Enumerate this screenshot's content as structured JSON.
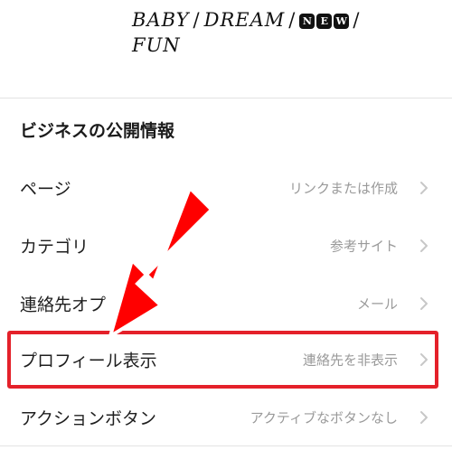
{
  "bio": {
    "line1_a": "BABY",
    "line1_b": "DREAM",
    "line1_badge": [
      "N",
      "E",
      "W"
    ],
    "line2": "FUN",
    "separator": "/"
  },
  "section": {
    "title": "ビジネスの公開情報"
  },
  "rows": [
    {
      "label": "ページ",
      "value": "リンクまたは作成"
    },
    {
      "label": "カテゴリ",
      "value": "参考サイト"
    },
    {
      "label": "連絡先オプ",
      "value": "メール"
    },
    {
      "label": "プロフィール表示",
      "value": "連絡先を非表示"
    },
    {
      "label": "アクションボタン",
      "value": "アクティブなボタンなし"
    }
  ],
  "colors": {
    "highlight": "#e4212a",
    "arrow": "#ff0000",
    "value_text": "#9a9a9a",
    "chevron": "#c7c7c7"
  },
  "icons": {
    "row_chevron": "chevron-right-icon",
    "annotation_arrow": "arrow-pointer-icon"
  }
}
